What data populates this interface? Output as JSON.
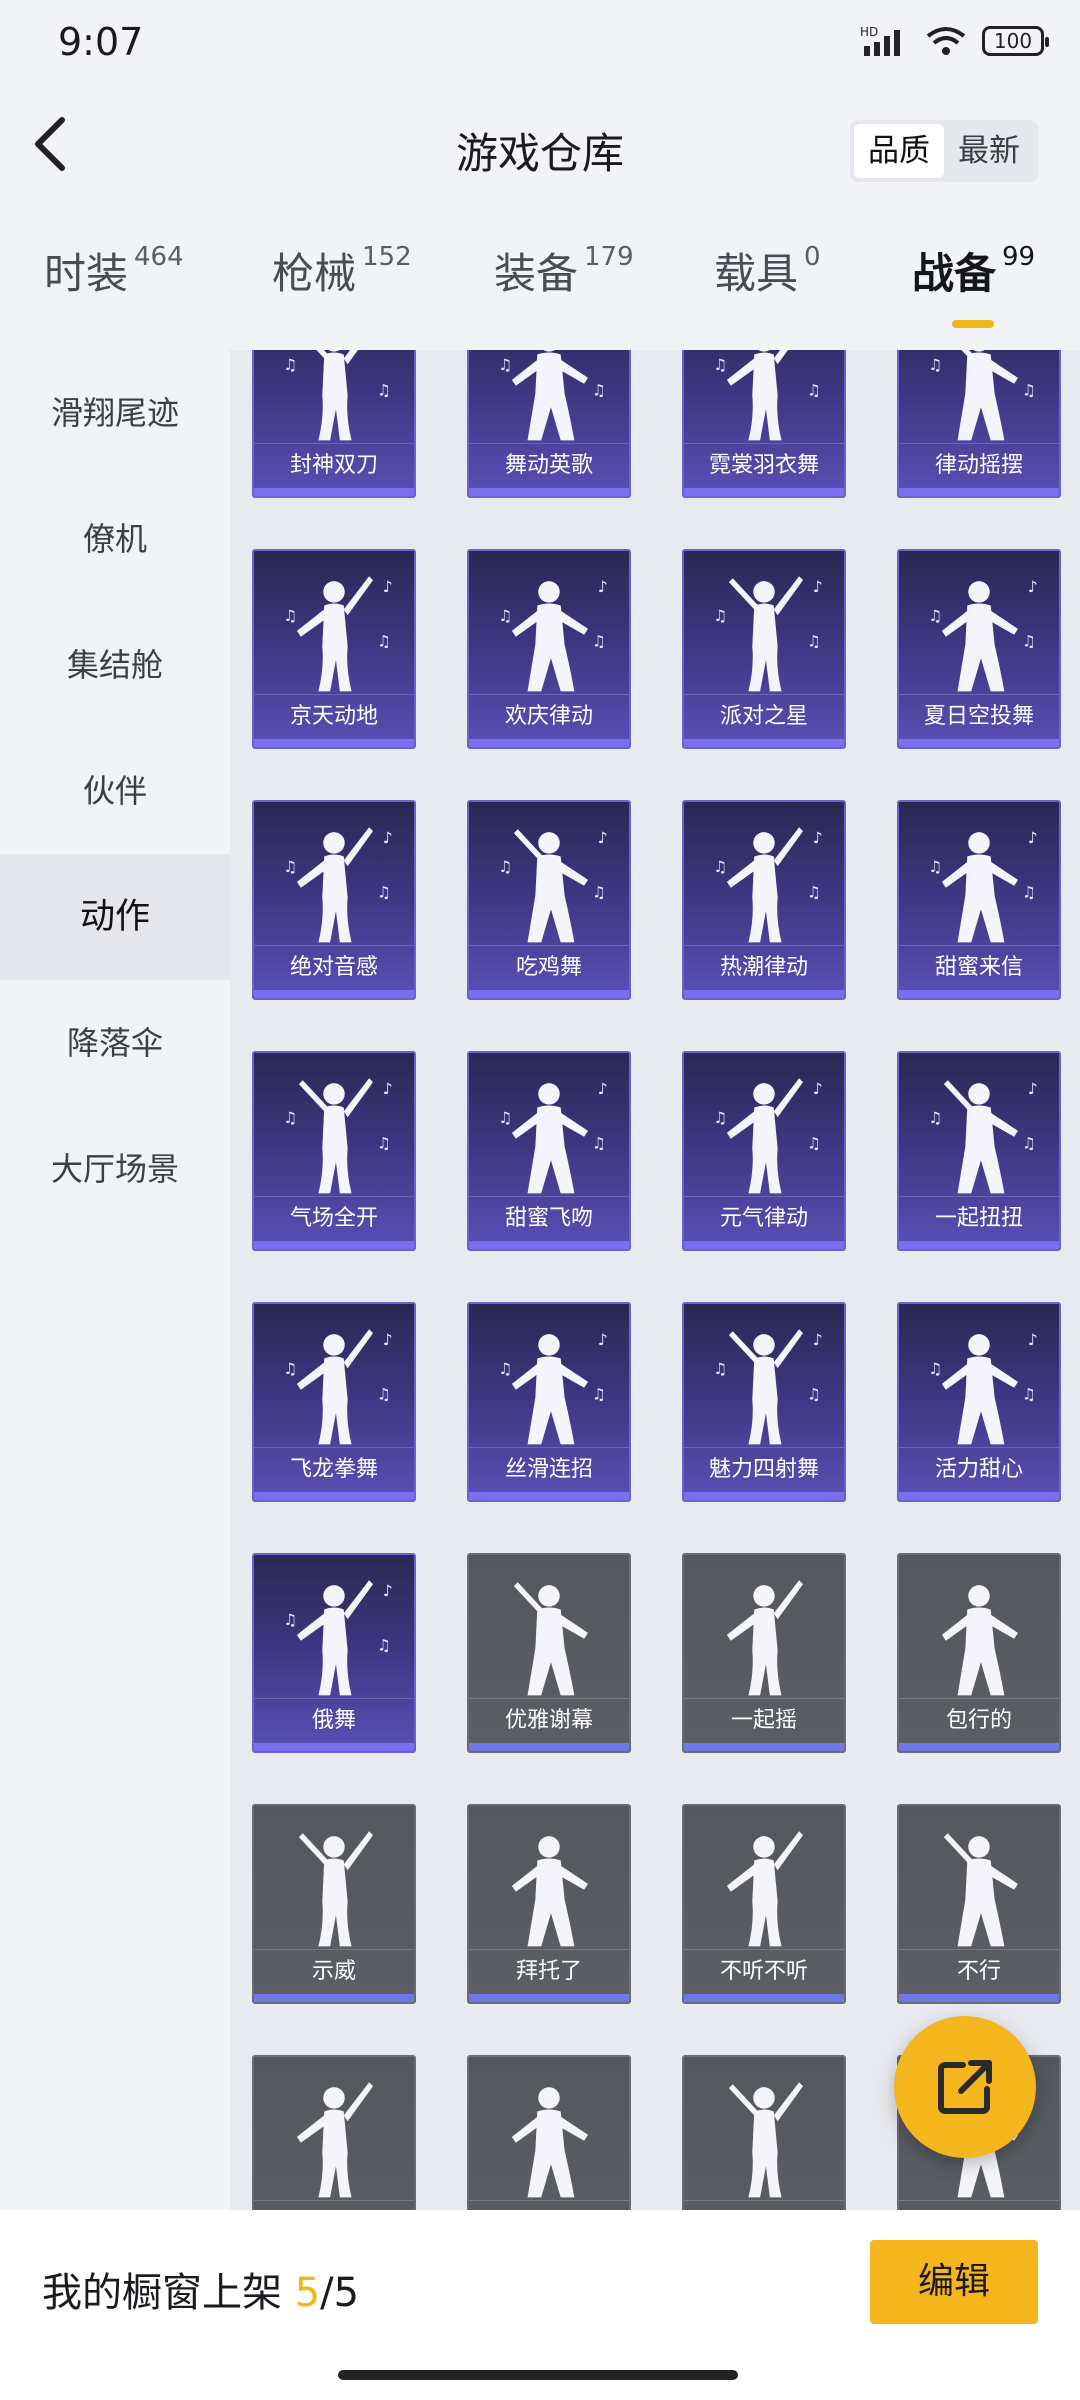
{
  "status": {
    "time": "9:07",
    "battery": "100",
    "network": "HD"
  },
  "header": {
    "title": "游戏仓库",
    "sort_options": [
      "品质",
      "最新"
    ],
    "active_sort": 0
  },
  "tabs": [
    {
      "label": "时装",
      "count": "464"
    },
    {
      "label": "枪械",
      "count": "152"
    },
    {
      "label": "装备",
      "count": "179"
    },
    {
      "label": "载具",
      "count": "0"
    },
    {
      "label": "战备",
      "count": "99"
    }
  ],
  "active_tab": 4,
  "sidebar": {
    "items": [
      "滑翔尾迹",
      "僚机",
      "集结舱",
      "伙伴",
      "动作",
      "降落伞",
      "大厅场景"
    ],
    "active": 4
  },
  "items": [
    {
      "name": "封神双刀",
      "style": "purple"
    },
    {
      "name": "舞动英歌",
      "style": "purple"
    },
    {
      "name": "霓裳羽衣舞",
      "style": "purple"
    },
    {
      "name": "律动摇摆",
      "style": "purple"
    },
    {
      "name": "京天动地",
      "style": "purple"
    },
    {
      "name": "欢庆律动",
      "style": "purple"
    },
    {
      "name": "派对之星",
      "style": "purple"
    },
    {
      "name": "夏日空投舞",
      "style": "purple"
    },
    {
      "name": "绝对音感",
      "style": "purple"
    },
    {
      "name": "吃鸡舞",
      "style": "purple"
    },
    {
      "name": "热潮律动",
      "style": "purple"
    },
    {
      "name": "甜蜜来信",
      "style": "purple"
    },
    {
      "name": "气场全开",
      "style": "purple"
    },
    {
      "name": "甜蜜飞吻",
      "style": "purple"
    },
    {
      "name": "元气律动",
      "style": "purple"
    },
    {
      "name": "一起扭扭",
      "style": "purple"
    },
    {
      "name": "飞龙拳舞",
      "style": "purple"
    },
    {
      "name": "丝滑连招",
      "style": "purple"
    },
    {
      "name": "魅力四射舞",
      "style": "purple"
    },
    {
      "name": "活力甜心",
      "style": "purple"
    },
    {
      "name": "俄舞",
      "style": "purple"
    },
    {
      "name": "优雅谢幕",
      "style": "grey"
    },
    {
      "name": "一起摇",
      "style": "grey"
    },
    {
      "name": "包行的",
      "style": "grey"
    },
    {
      "name": "示威",
      "style": "grey"
    },
    {
      "name": "拜托了",
      "style": "grey"
    },
    {
      "name": "不听不听",
      "style": "grey"
    },
    {
      "name": "不行",
      "style": "grey"
    },
    {
      "name": "",
      "style": "grey"
    },
    {
      "name": "",
      "style": "grey"
    },
    {
      "name": "",
      "style": "grey"
    },
    {
      "name": "",
      "style": "grey"
    }
  ],
  "bottom": {
    "shelf_label": "我的橱窗上架",
    "shelf_current": "5",
    "shelf_total": "/5",
    "edit_label": "编辑"
  },
  "colors": {
    "accent": "#f5b51c",
    "card_purple": "#3d3580",
    "card_grey": "#5c5e66"
  }
}
